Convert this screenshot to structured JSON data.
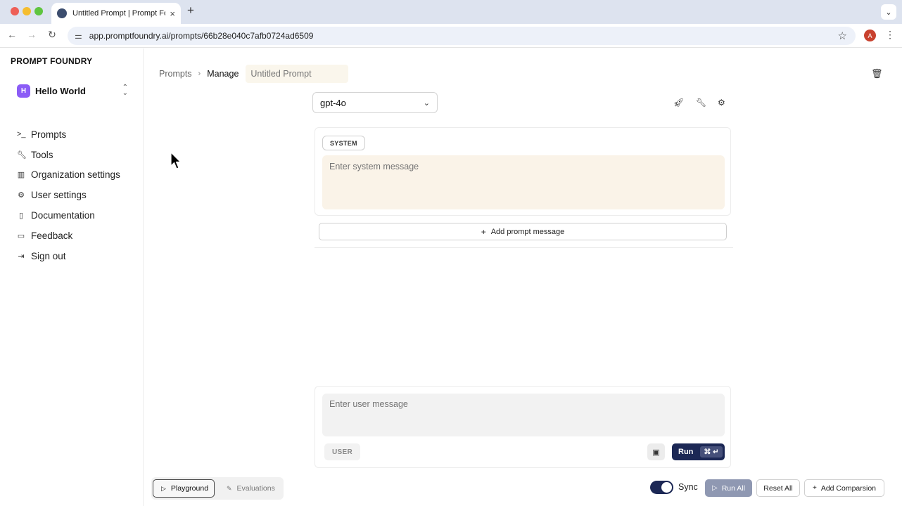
{
  "browser": {
    "tab_title": "Untitled Prompt | Prompt Foundry",
    "tab_close": "×",
    "new_tab": "+",
    "url": "app.promptfoundry.ai/prompts/66b28e040c7afb0724ad6509",
    "profile_initial": "A"
  },
  "sidebar": {
    "brand": "PROMPT FOUNDRY",
    "org_initial": "H",
    "org_name": "Hello World",
    "items": [
      {
        "label": "Prompts",
        "icon": "terminal-icon"
      },
      {
        "label": "Tools",
        "icon": "wrench-icon"
      },
      {
        "label": "Organization settings",
        "icon": "building-icon"
      },
      {
        "label": "User settings",
        "icon": "gear-icon"
      },
      {
        "label": "Documentation",
        "icon": "book-icon"
      },
      {
        "label": "Feedback",
        "icon": "message-icon"
      },
      {
        "label": "Sign out",
        "icon": "sign-out-icon"
      }
    ]
  },
  "header": {
    "breadcrumb_prompts": "Prompts",
    "breadcrumb_manage": "Manage",
    "title_placeholder": "Untitled Prompt"
  },
  "editor": {
    "model": "gpt-4o",
    "system_role": "SYSTEM",
    "system_placeholder": "Enter system message",
    "add_message_label": "Add prompt message",
    "user_placeholder": "Enter user message",
    "user_role": "USER",
    "run_label": "Run",
    "run_shortcut": "⌘ ↵"
  },
  "footer": {
    "playground_label": "Playground",
    "evaluations_label": "Evaluations",
    "sync_label": "Sync",
    "sync_on": true,
    "run_all_label": "Run All",
    "reset_all_label": "Reset All",
    "add_comparison_label": "Add Comparsion"
  },
  "colors": {
    "accent": "#1c2855",
    "org_logo": "#8b5cf6",
    "system_bg": "#faf3e8"
  }
}
